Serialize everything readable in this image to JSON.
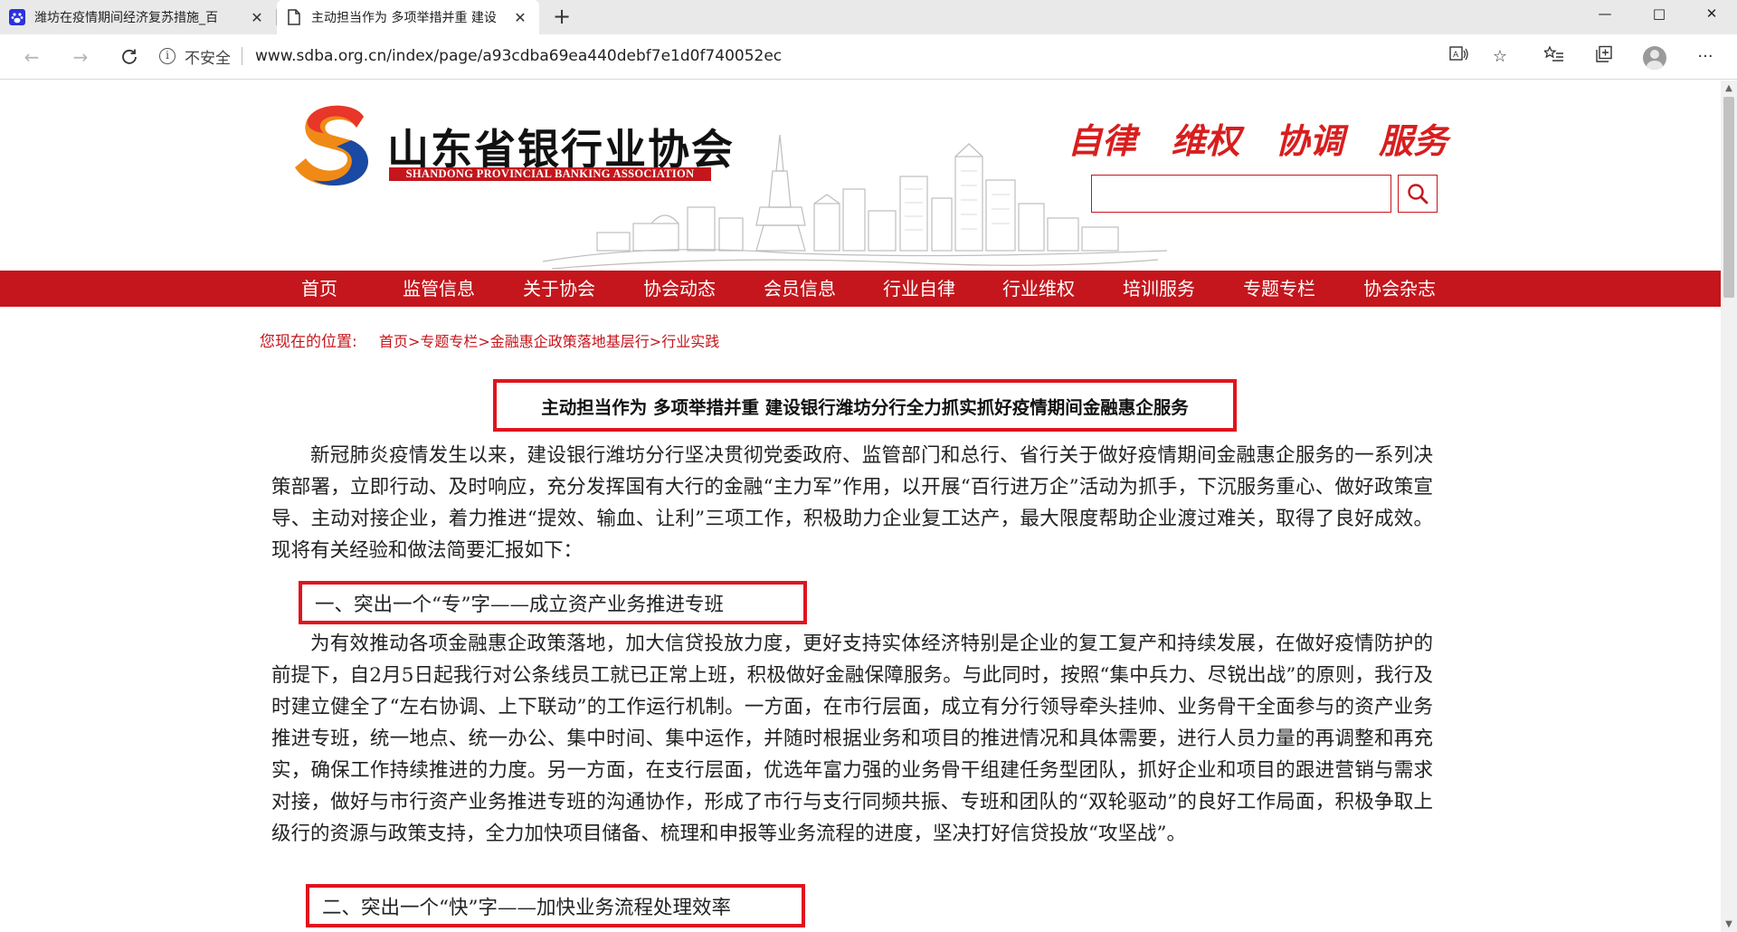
{
  "browser": {
    "tabs": [
      {
        "title": "潍坊在疫情期间经济复苏措施_百",
        "active": false,
        "icon": "baidu-paw-icon"
      },
      {
        "title": "主动担当作为 多项举措并重 建设",
        "active": true,
        "icon": "page-icon"
      }
    ],
    "new_tab": "+",
    "window_controls": {
      "minimize": "—",
      "maximize": "□",
      "close": "✕"
    },
    "security_label": "不安全",
    "url": "www.sdba.org.cn/index/page/a93cdba69ea440debf7e1d0f740052ec"
  },
  "site": {
    "org_name_cn": "山东省银行业协会",
    "org_name_en": "SHANDONG PROVINCIAL BANKING ASSOCIATION",
    "slogans": [
      "自律",
      "维权",
      "协调",
      "服务"
    ],
    "search": {
      "placeholder": "",
      "value": ""
    },
    "accent_color": "#c4161c"
  },
  "nav": [
    "首页",
    "监管信息",
    "关于协会",
    "协会动态",
    "会员信息",
    "行业自律",
    "行业维权",
    "培训服务",
    "专题专栏",
    "协会杂志"
  ],
  "breadcrumb": {
    "lead": "您现在的位置:",
    "items": [
      "首页",
      "专题专栏",
      "金融惠企政策落地基层行",
      "行业实践"
    ],
    "separator": ">"
  },
  "article": {
    "title": "主动担当作为 多项举措并重 建设银行潍坊分行全力抓实抓好疫情期间金融惠企服务",
    "para1": "新冠肺炎疫情发生以来，建设银行潍坊分行坚决贯彻党委政府、监管部门和总行、省行关于做好疫情期间金融惠企服务的一系列决策部署，立即行动、及时响应，充分发挥国有大行的金融“主力军”作用，以开展“百行进万企”活动为抓手，下沉服务重心、做好政策宣导、主动对接企业，着力推进“提效、输血、让利”三项工作，积极助力企业复工达产，最大限度帮助企业渡过难关，取得了良好成效。现将有关经验和做法简要汇报如下：",
    "section1": "一、突出一个“专”字——成立资产业务推进专班",
    "para2": "为有效推动各项金融惠企政策落地，加大信贷投放力度，更好支持实体经济特别是企业的复工复产和持续发展，在做好疫情防护的前提下，自2月5日起我行对公条线员工就已正常上班，积极做好金融保障服务。与此同时，按照“集中兵力、尽锐出战”的原则，我行及时建立健全了“左右协调、上下联动”的工作运行机制。一方面，在市行层面，成立有分行领导牵头挂帅、业务骨干全面参与的资产业务推进专班，统一地点、统一办公、集中时间、集中运作，并随时根据业务和项目的推进情况和具体需要，进行人员力量的再调整和再充实，确保工作持续推进的力度。另一方面，在支行层面，优选年富力强的业务骨干组建任务型团队，抓好企业和项目的跟进营销与需求对接，做好与市行资产业务推进专班的沟通协作，形成了市行与支行同频共振、专班和团队的“双轮驱动”的良好工作局面，积极争取上级行的资源与政策支持，全力加快项目储备、梳理和申报等业务流程的进度，坚决打好信贷投放“攻坚战”。",
    "section2": "二、突出一个“快”字——加快业务流程处理效率"
  }
}
